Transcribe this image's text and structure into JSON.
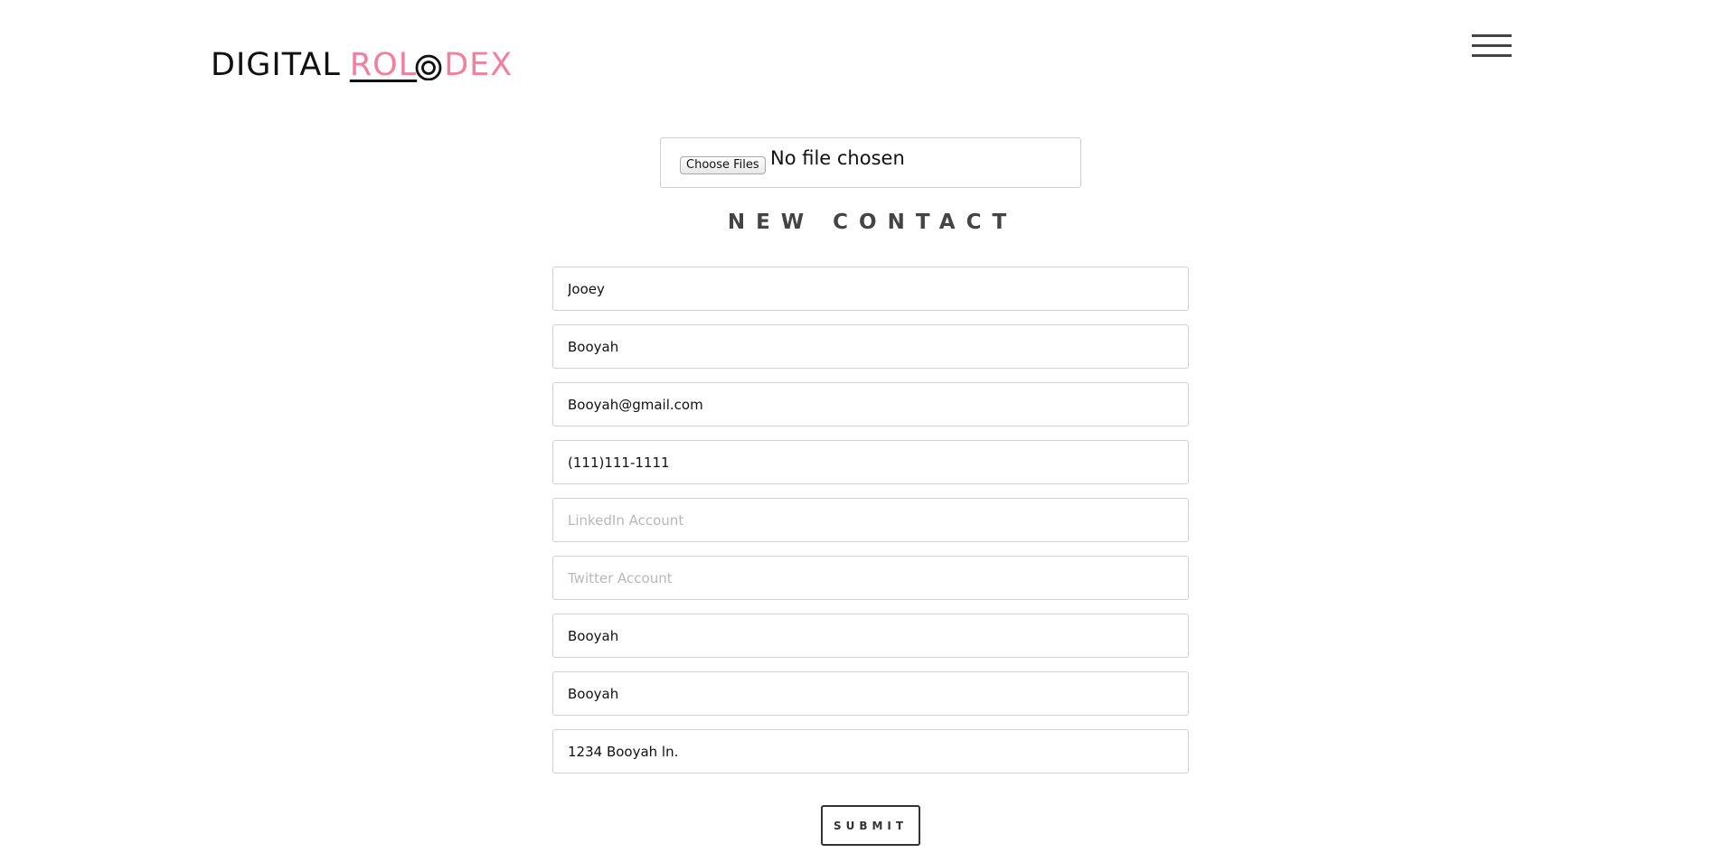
{
  "header": {
    "logo": {
      "part_digital": "DIGITAL",
      "part_rolo": "ROL",
      "part_dex": "DEX"
    },
    "menu_icon": "hamburger-menu-icon"
  },
  "file_upload": {
    "button_label": "Choose Files",
    "status_text": "No file chosen"
  },
  "form": {
    "title": "NEW CONTACT",
    "fields": [
      {
        "value": "Jooey",
        "placeholder": ""
      },
      {
        "value": "Booyah",
        "placeholder": ""
      },
      {
        "value": "Booyah@gmail.com",
        "placeholder": ""
      },
      {
        "value": "(111)111-1111",
        "placeholder": ""
      },
      {
        "value": "",
        "placeholder": "LinkedIn Account"
      },
      {
        "value": "",
        "placeholder": "Twitter Account"
      },
      {
        "value": "Booyah",
        "placeholder": ""
      },
      {
        "value": "Booyah",
        "placeholder": ""
      },
      {
        "value": "1234 Booyah ln.",
        "placeholder": ""
      }
    ],
    "submit_label": "SUBMIT"
  },
  "colors": {
    "brand_pink": "#f0809e",
    "text_dark": "#111111",
    "border": "#d0d0d0"
  }
}
